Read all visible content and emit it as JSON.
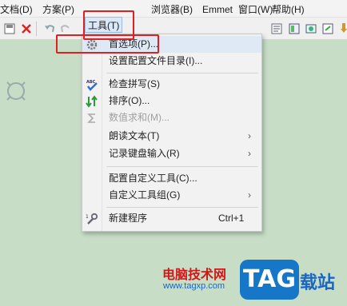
{
  "menubar": {
    "items": [
      "文档(D)",
      "方案(P)",
      "工具(T)",
      "浏览器(B)",
      "Emmet",
      "窗口(W)",
      "帮助(H)"
    ],
    "active_index": 2
  },
  "toolbar": {
    "left_icons": [
      "save-icon",
      "close-icon",
      "undo-icon",
      "redo-icon",
      "settings-icon"
    ],
    "right_icons": [
      "document-icon",
      "panel-icon",
      "browser-icon",
      "window-icon",
      "pin-icon"
    ]
  },
  "editor": {
    "cursor_icon": "crosshair-circle-icon"
  },
  "tools_menu": {
    "items": [
      {
        "label": "首选项(P)...",
        "icon": "gear-icon",
        "shortcut": "",
        "submenu": false,
        "disabled": false,
        "highlighted": true
      },
      {
        "label": "设置配置文件目录(I)...",
        "icon": "",
        "shortcut": "",
        "submenu": false,
        "disabled": false,
        "highlighted": false
      },
      {
        "label": "检查拼写(S)",
        "icon": "spellcheck-icon",
        "shortcut": "",
        "submenu": false,
        "disabled": false,
        "highlighted": false
      },
      {
        "label": "排序(O)...",
        "icon": "sort-icon",
        "shortcut": "",
        "submenu": false,
        "disabled": false,
        "highlighted": false
      },
      {
        "label": "数值求和(M)...",
        "icon": "sum-icon",
        "shortcut": "",
        "submenu": false,
        "disabled": true,
        "highlighted": false
      },
      {
        "label": "朗读文本(T)",
        "icon": "",
        "shortcut": "",
        "submenu": true,
        "disabled": false,
        "highlighted": false
      },
      {
        "label": "记录键盘输入(R)",
        "icon": "",
        "shortcut": "",
        "submenu": true,
        "disabled": false,
        "highlighted": false
      },
      {
        "label": "配置自定义工具(C)...",
        "icon": "",
        "shortcut": "",
        "submenu": false,
        "disabled": false,
        "highlighted": false
      },
      {
        "label": "自定义工具组(G)",
        "icon": "",
        "shortcut": "",
        "submenu": true,
        "disabled": false,
        "highlighted": false
      },
      {
        "label": "新建程序",
        "icon": "wrench-icon",
        "shortcut": "Ctrl+1",
        "submenu": false,
        "disabled": false,
        "highlighted": false
      }
    ],
    "arrow_glyph": "›"
  },
  "watermark": {
    "site_name": "电脑技术网",
    "site_url": "www.tagxp.com",
    "logo_text": "TAG",
    "logo_suffix": "载站"
  },
  "colors": {
    "annotation_red": "#e02020",
    "editor_bg": "#c7ddc6",
    "menu_bg": "#f2f2f2",
    "highlight": "#dfe9f6",
    "logo_blue": "#1677c9"
  }
}
